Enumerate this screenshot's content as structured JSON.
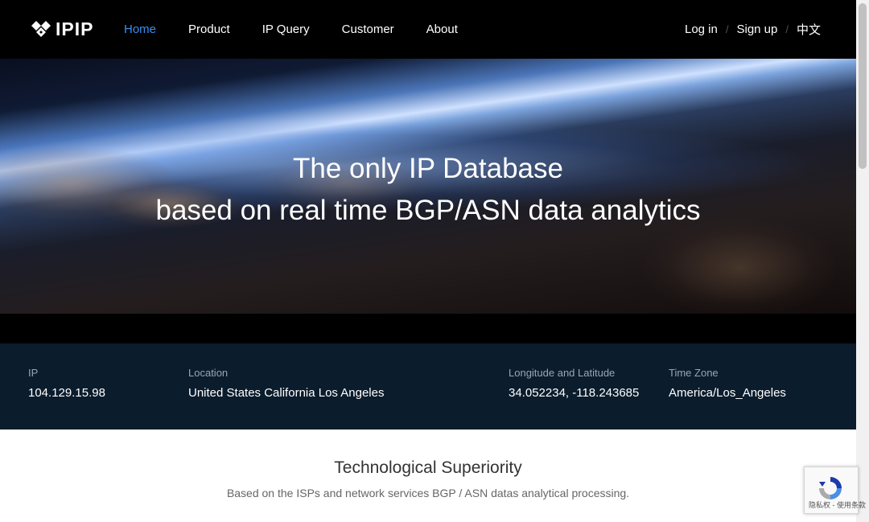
{
  "brand": {
    "logo_text": "IPIP"
  },
  "nav": {
    "items": [
      {
        "label": "Home",
        "active": true
      },
      {
        "label": "Product",
        "active": false
      },
      {
        "label": "IP Query",
        "active": false
      },
      {
        "label": "Customer",
        "active": false
      },
      {
        "label": "About",
        "active": false
      }
    ],
    "right": {
      "login": "Log in",
      "signup": "Sign up",
      "language": "中文",
      "separator": "/"
    }
  },
  "hero": {
    "line1": "The only IP Database",
    "line2": "based on real time BGP/ASN data analytics"
  },
  "ip_info": {
    "ip": {
      "label": "IP",
      "value": "104.129.15.98"
    },
    "location": {
      "label": "Location",
      "value": "United States California Los Angeles"
    },
    "coords": {
      "label": "Longitude and Latitude",
      "value": "34.052234, -118.243685"
    },
    "timezone": {
      "label": "Time Zone",
      "value": "America/Los_Angeles"
    }
  },
  "section": {
    "title": "Technological Superiority",
    "subtitle": "Based on the ISPs and network services BGP / ASN datas analytical processing."
  },
  "recaptcha": {
    "text": "隐私权 - 使用条款",
    "icon": "recaptcha-icon"
  },
  "colors": {
    "accent": "#3b8ff0",
    "info_bg": "#0b1c2c",
    "nav_bg": "#000000"
  }
}
